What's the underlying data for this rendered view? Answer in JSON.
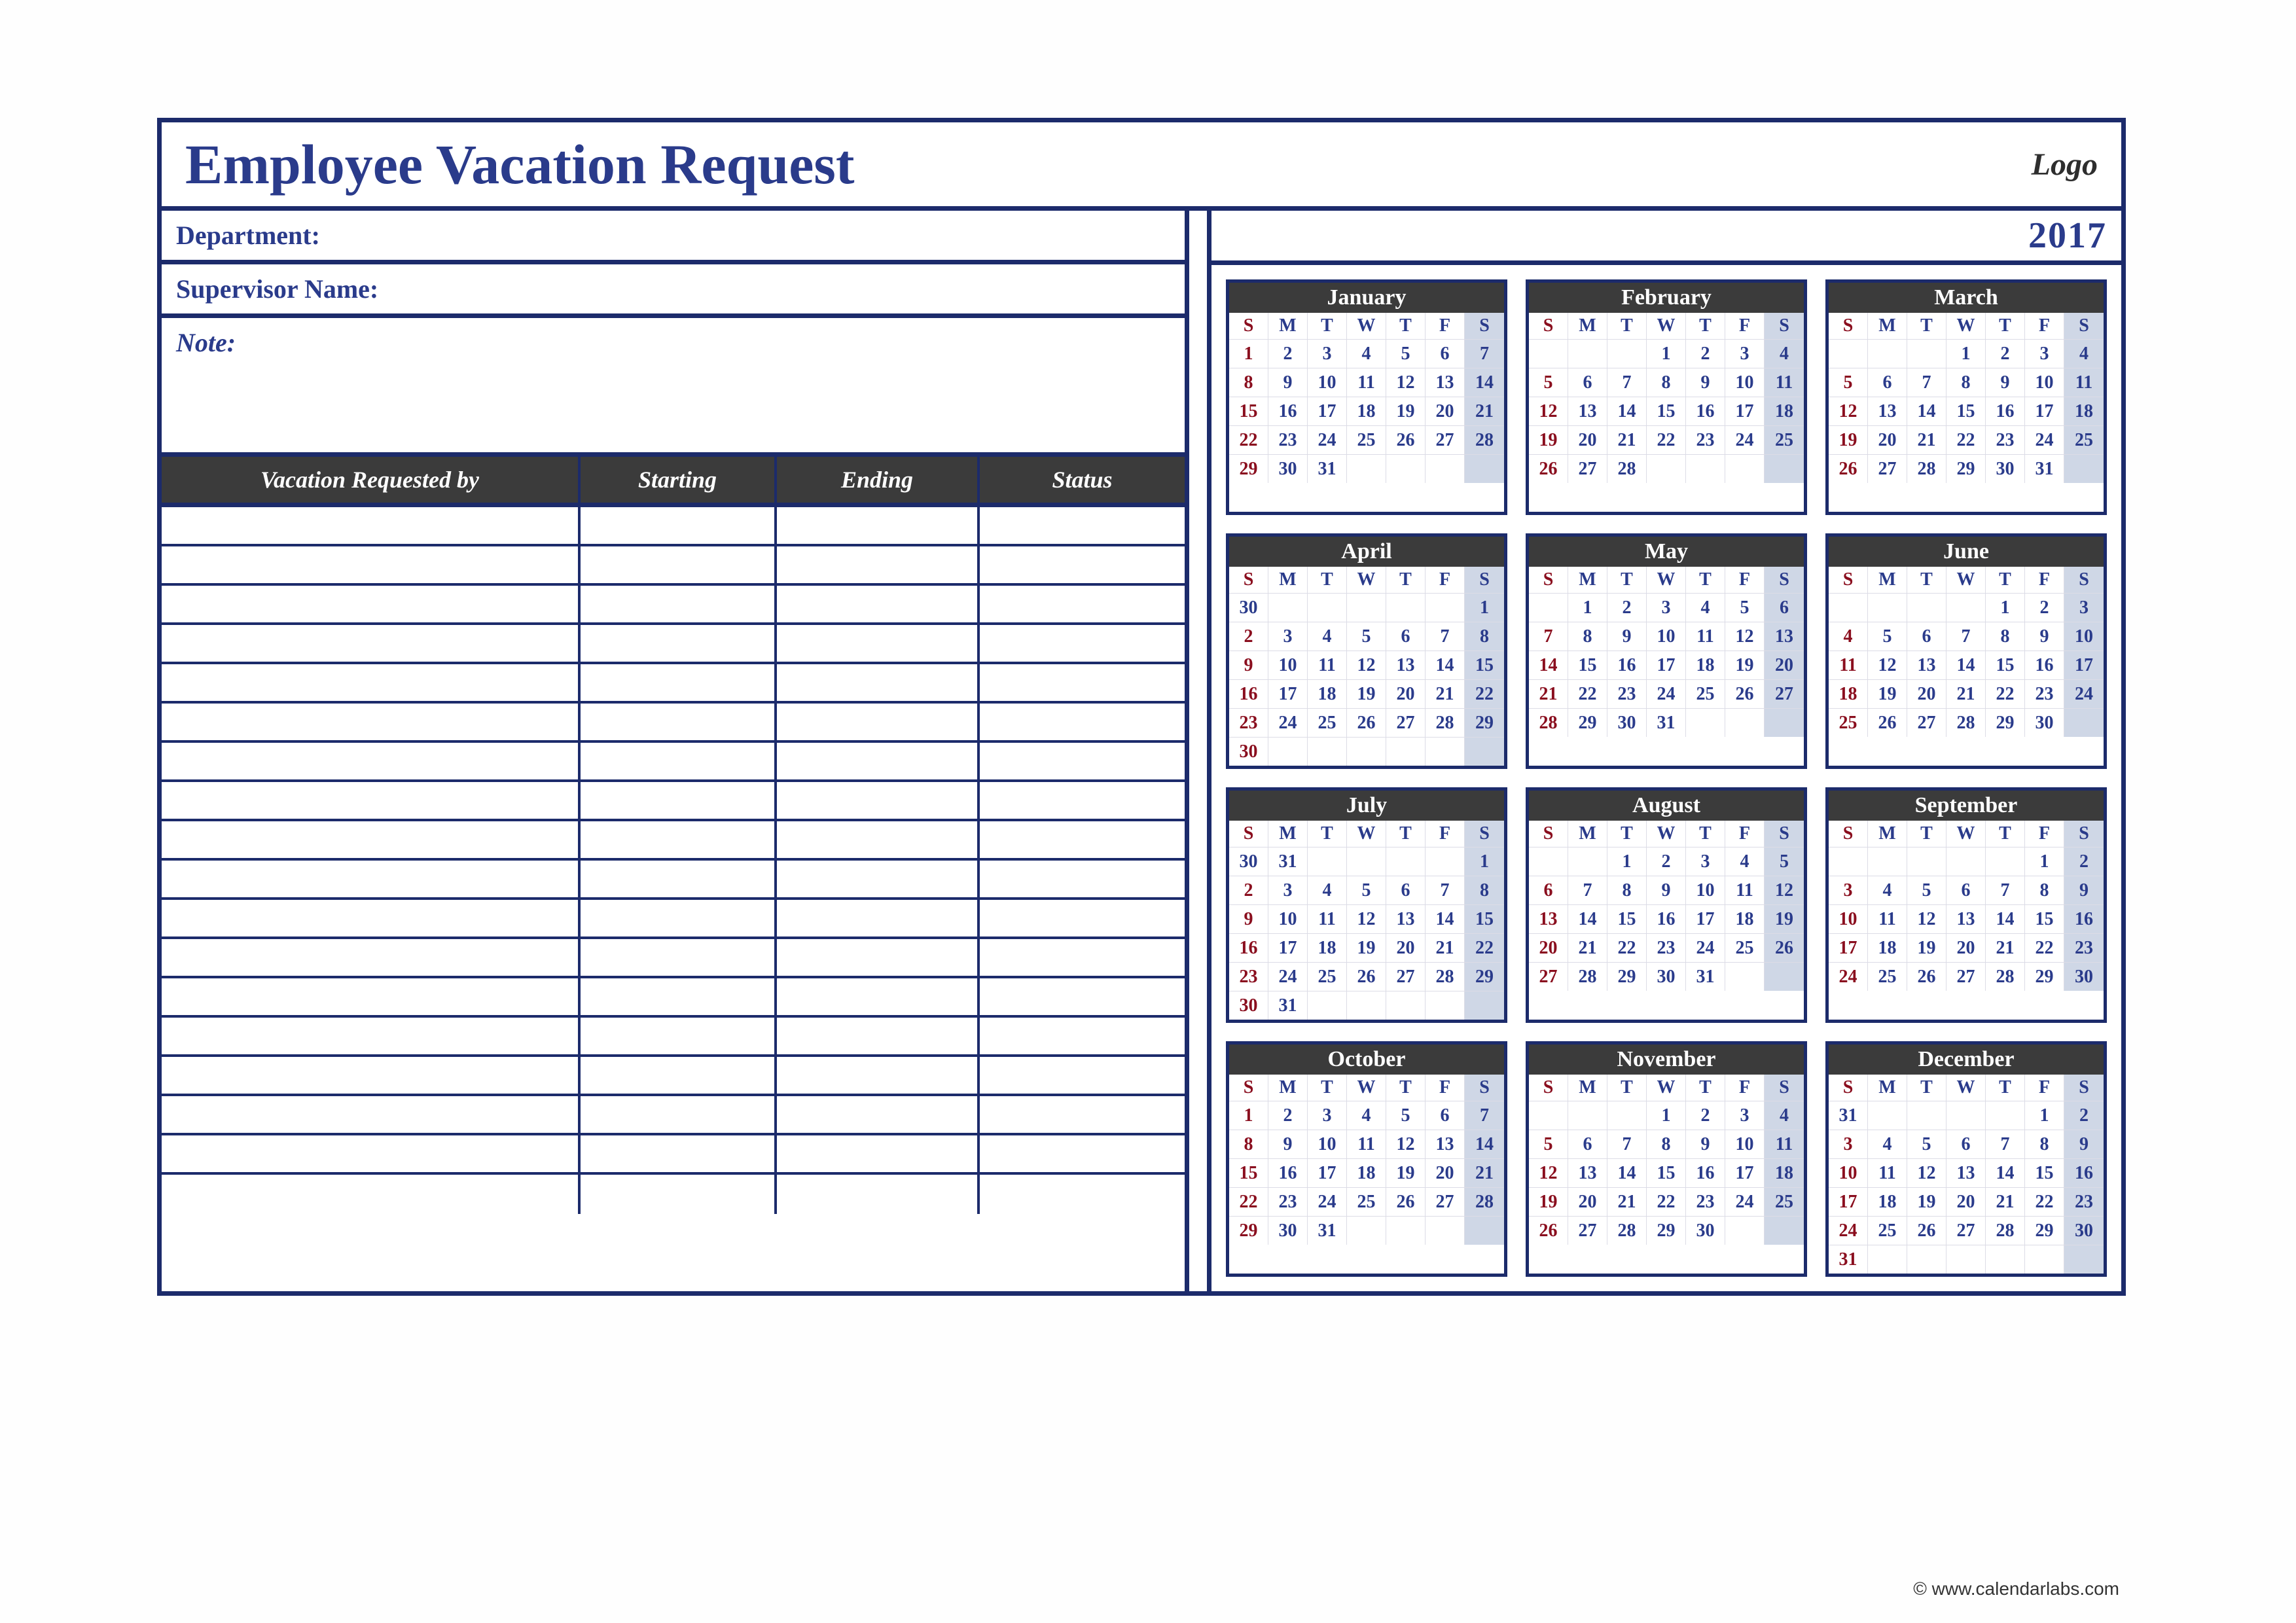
{
  "title": "Employee Vacation Request",
  "logo": "Logo",
  "fields": {
    "department_label": "Department:",
    "supervisor_label": "Supervisor Name:",
    "note_label": "Note:"
  },
  "columns": {
    "requested_by": "Vacation Requested by",
    "starting": "Starting",
    "ending": "Ending",
    "status": "Status"
  },
  "request_row_count": 18,
  "year": "2017",
  "dow": [
    "S",
    "M",
    "T",
    "W",
    "T",
    "F",
    "S"
  ],
  "months": [
    {
      "name": "January",
      "start": 0,
      "days": 31
    },
    {
      "name": "February",
      "start": 3,
      "days": 28
    },
    {
      "name": "March",
      "start": 3,
      "days": 31
    },
    {
      "name": "April",
      "start": 6,
      "days": 30,
      "showPrev": "30"
    },
    {
      "name": "May",
      "start": 1,
      "days": 31
    },
    {
      "name": "June",
      "start": 4,
      "days": 30
    },
    {
      "name": "July",
      "start": 6,
      "days": 31,
      "showPrev": "30,31"
    },
    {
      "name": "August",
      "start": 2,
      "days": 31
    },
    {
      "name": "September",
      "start": 5,
      "days": 30
    },
    {
      "name": "October",
      "start": 0,
      "days": 31
    },
    {
      "name": "November",
      "start": 3,
      "days": 30
    },
    {
      "name": "December",
      "start": 5,
      "days": 31,
      "showPrev": "31"
    }
  ],
  "credit": "© www.calendarlabs.com"
}
